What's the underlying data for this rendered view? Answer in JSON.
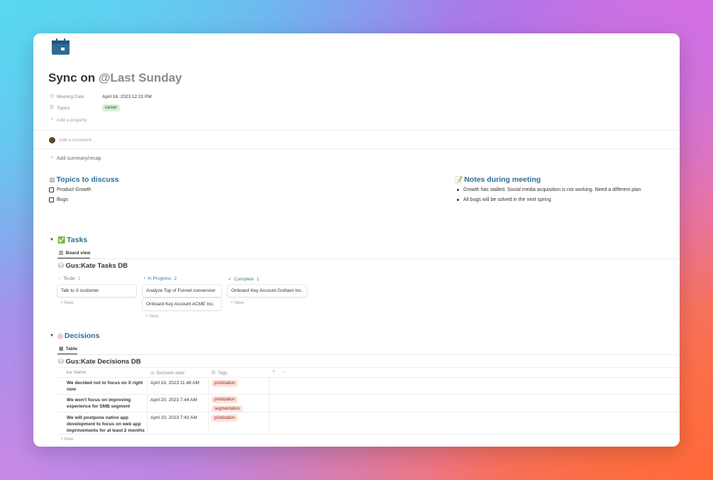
{
  "page": {
    "title": "Sync on",
    "title_mention": "@Last Sunday",
    "icon": "calendar-icon",
    "accent_color": "#2f6c95"
  },
  "properties": [
    {
      "label": "Meeting Date",
      "icon": "clock-icon",
      "value": "April 16, 2023 12:21 PM"
    },
    {
      "label": "Topics",
      "icon": "list-icon",
      "tag": "career"
    }
  ],
  "add_property_label": "Add a property",
  "comment_placeholder": "Add a comment...",
  "add_summary_label": "Add summary/recap",
  "topics_section": {
    "title": "Topics to discuss",
    "items": [
      "Product Growth",
      "Bugs"
    ]
  },
  "notes_section": {
    "title": "Notes during meeting",
    "items": [
      "Growth has stalled. Social media acquisition is not working. Need a different plan",
      "All bugs will be solved in the next spring"
    ]
  },
  "tasks_section": {
    "title": "Tasks",
    "view_tab": "Board view",
    "db_title": "Gus:Kate Tasks DB",
    "new_label": "New",
    "columns": [
      {
        "name": "To-do",
        "count": "1",
        "color": "#8c8b87",
        "cards": [
          "Talk to X customer"
        ]
      },
      {
        "name": "In Progress",
        "count": "2",
        "color": "#337ea9",
        "cards": [
          "Analyze Top of Funnel conversion",
          "Onboard Key Account ACME Inc."
        ]
      },
      {
        "name": "Complete",
        "count": "1",
        "color": "#448361",
        "cards": [
          "Onboard Key Account Gotham Inc."
        ]
      }
    ]
  },
  "decisions_section": {
    "title": "Decisions",
    "view_tab": "Table",
    "db_title": "Gus:Kate Decisions DB",
    "new_label": "New",
    "headers": {
      "name": "Name",
      "date": "Decision date",
      "tags": "Tags",
      "add": "+",
      "more": "···"
    },
    "rows": [
      {
        "name": "We decided not to focus on X right now",
        "date": "April 16, 2023 11:48 AM",
        "tags": [
          "priotization"
        ]
      },
      {
        "name": "We won't focus on improving experience for SMB segment",
        "date": "April 20, 2023 7:44 AM",
        "tags": [
          "priotization",
          "segmentation"
        ]
      },
      {
        "name": "We will postpone native app development to focus on web app improvements for at least 2 months",
        "date": "April 20, 2023 7:43 AM",
        "tags": [
          "priotization"
        ]
      }
    ]
  }
}
